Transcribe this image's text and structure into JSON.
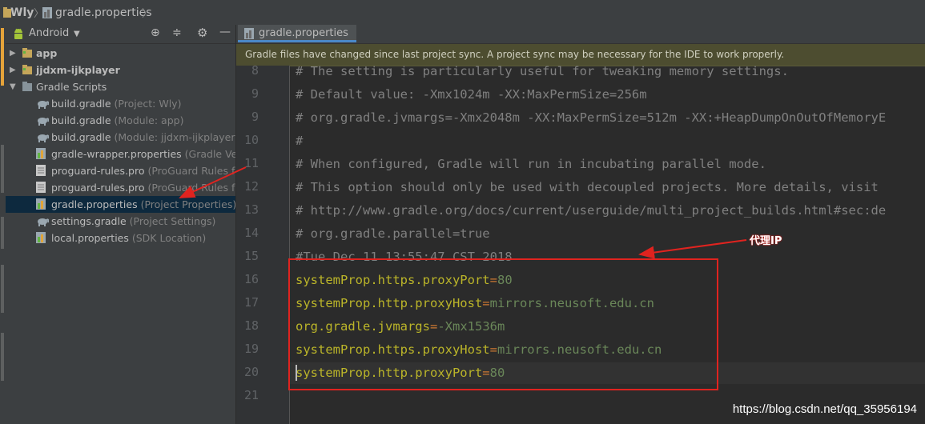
{
  "breadcrumb": {
    "project": "Wly",
    "file": "gradle.properties"
  },
  "project_panel": {
    "view_mode": "Android",
    "items": [
      {
        "name": "app",
        "desc": "",
        "icon": "folder-icon",
        "bold": true,
        "arrow": "▶"
      },
      {
        "name": "jjdxm-ijkplayer",
        "desc": "",
        "icon": "folder-icon",
        "bold": true,
        "arrow": "▶"
      },
      {
        "name": "Gradle Scripts",
        "desc": "",
        "icon": "gradle-folder-icon",
        "bold": false,
        "arrow": "▼"
      },
      {
        "name": "build.gradle",
        "desc": "(Project: Wly)",
        "icon": "gradle-elephant-icon"
      },
      {
        "name": "build.gradle",
        "desc": "(Module: app)",
        "icon": "gradle-elephant-icon"
      },
      {
        "name": "build.gradle",
        "desc": "(Module: jjdxm-ijkplayer)",
        "icon": "gradle-elephant-icon"
      },
      {
        "name": "gradle-wrapper.properties",
        "desc": "(Gradle Vers",
        "icon": "properties-file-icon"
      },
      {
        "name": "proguard-rules.pro",
        "desc": "(ProGuard Rules for",
        "icon": "text-file-icon"
      },
      {
        "name": "proguard-rules.pro",
        "desc": "(ProGuard Rules for",
        "icon": "text-file-icon"
      },
      {
        "name": "gradle.properties",
        "desc": "(Project Properties)",
        "icon": "properties-file-icon",
        "selected": true
      },
      {
        "name": "settings.gradle",
        "desc": "(Project Settings)",
        "icon": "gradle-elephant-icon"
      },
      {
        "name": "local.properties",
        "desc": "(SDK Location)",
        "icon": "properties-file-icon"
      }
    ]
  },
  "editor": {
    "tab_label": "gradle.properties",
    "banner": "Gradle files have changed since last project sync. A project sync may be necessary for the IDE to work properly.",
    "lines": [
      {
        "num": "8",
        "text": "# The setting is particularly useful for tweaking memory settings."
      },
      {
        "num": "9",
        "text": "# Default value: -Xmx1024m -XX:MaxPermSize=256m"
      },
      {
        "num": "9",
        "text": "# org.gradle.jvmargs=-Xmx2048m -XX:MaxPermSize=512m -XX:+HeapDumpOnOutOfMemoryE"
      },
      {
        "num": "10",
        "text": "#"
      },
      {
        "num": "11",
        "text": "# When configured, Gradle will run in incubating parallel mode."
      },
      {
        "num": "12",
        "text": "# This option should only be used with decoupled projects. More details, visit"
      },
      {
        "num": "13",
        "text": "# http://www.gradle.org/docs/current/userguide/multi_project_builds.html#sec:de"
      },
      {
        "num": "14",
        "text": "# org.gradle.parallel=true"
      },
      {
        "num": "15",
        "text": "#Tue Dec 11 13:55:47 CST 2018"
      },
      {
        "num": "16",
        "key": "systemProp.https.proxyPort",
        "eq": "=",
        "value": "80"
      },
      {
        "num": "17",
        "key": "systemProp.http.proxyHost",
        "eq": "=",
        "value": "mirrors.neusoft.edu.cn"
      },
      {
        "num": "18",
        "key": "org.gradle.jvmargs",
        "eq": "=",
        "value": "-Xmx1536m"
      },
      {
        "num": "19",
        "key": "systemProp.https.proxyHost",
        "eq": "=",
        "value": "mirrors.neusoft.edu.cn"
      },
      {
        "num": "20",
        "key": "systemProp.http.proxyPort",
        "eq": "=",
        "value": "80"
      },
      {
        "num": "21",
        "text": ""
      }
    ]
  },
  "annotation": {
    "label": "代理IP",
    "color": "#e0231f"
  },
  "watermark": "https://blog.csdn.net/qq_35956194"
}
